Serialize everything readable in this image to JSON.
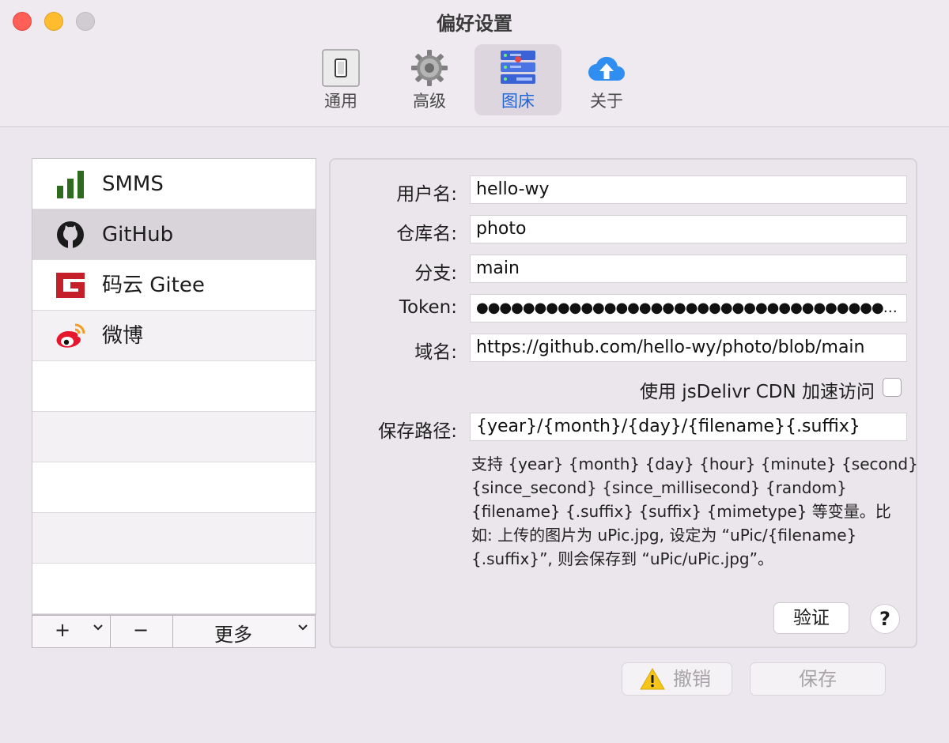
{
  "window": {
    "title": "偏好设置"
  },
  "toolbar": {
    "tabs": [
      {
        "label": "通用",
        "icon": "switch-icon"
      },
      {
        "label": "高级",
        "icon": "gear-icon"
      },
      {
        "label": "图床",
        "icon": "server-icon",
        "active": true
      },
      {
        "label": "关于",
        "icon": "cloud-upload-icon"
      }
    ]
  },
  "hosts": {
    "items": [
      {
        "label": "SMMS",
        "icon": "signal-bars-icon"
      },
      {
        "label": "GitHub",
        "icon": "github-icon",
        "selected": true
      },
      {
        "label": "码云 Gitee",
        "icon": "gitee-icon"
      },
      {
        "label": "微博",
        "icon": "weibo-icon"
      }
    ],
    "empty_rows": 5,
    "add_label": "+",
    "remove_label": "−",
    "more_label": "更多"
  },
  "form": {
    "username": {
      "label": "用户名:",
      "value": "hello-wy"
    },
    "repo": {
      "label": "仓库名:",
      "value": "photo"
    },
    "branch": {
      "label": "分支:",
      "value": "main"
    },
    "token": {
      "label": "Token:",
      "value": "●●●●●●●●●●●●●●●●●●●●●●●●●●●●●●●●●●●●●●●●"
    },
    "domain": {
      "label": "域名:",
      "value": "https://github.com/hello-wy/photo/blob/main"
    },
    "cdn": {
      "label": "使用 jsDelivr CDN 加速访问",
      "checked": false
    },
    "save_path": {
      "label": "保存路径:",
      "value": "{year}/{month}/{day}/{filename}{.suffix}"
    },
    "help_lines": [
      "支持 {year} {month} {day} {hour} {minute} {second}",
      "{since_second} {since_millisecond} {random}",
      "{filename} {.suffix} {suffix} {mimetype} 等变量。比",
      "如: 上传的图片为 uPic.jpg, 设定为 “uPic/{filename}",
      "{.suffix}”, 则会保存到 “uPic/uPic.jpg”。"
    ],
    "verify_label": "验证",
    "help_button_label": "?"
  },
  "actions": {
    "undo_label": "撤销",
    "save_label": "保存"
  },
  "colors": {
    "accent": "#2064d8",
    "close": "#fe5f57",
    "minimize": "#febc2e",
    "disabled_text": "#a7a3a8"
  }
}
